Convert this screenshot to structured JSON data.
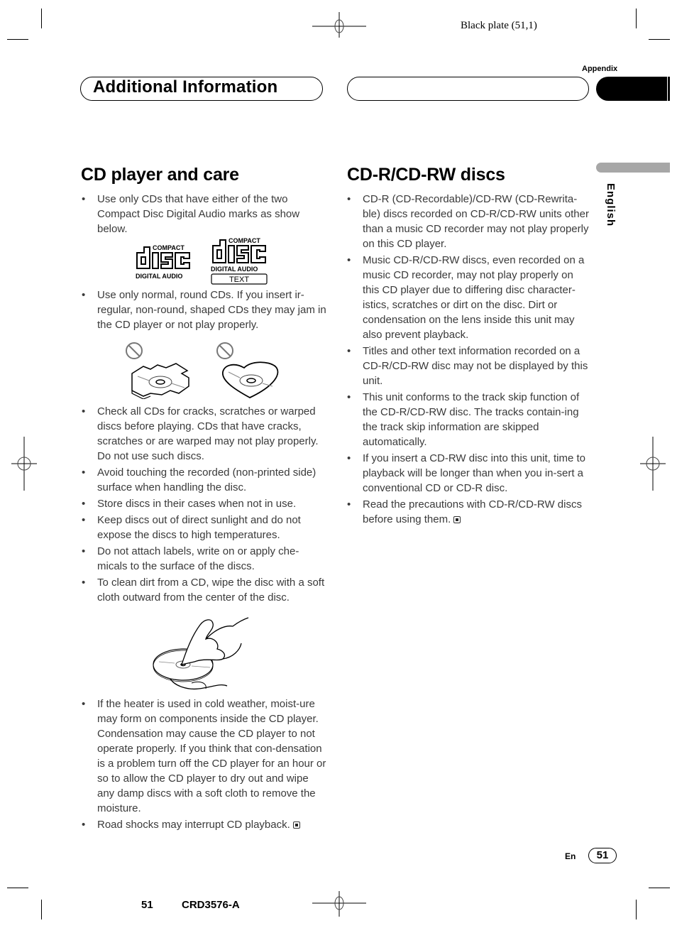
{
  "print_marks": {
    "plate_label": "Black plate (51,1)",
    "footer_page": "51",
    "footer_model": "CRD3576-A"
  },
  "header": {
    "section_title": "Additional Information",
    "chapter_label": "Appendix",
    "language_tab": "English"
  },
  "left_column": {
    "title": "CD player and care",
    "bullets_before_logos": [
      "Use only CDs that have either of the two Compact Disc Digital Audio marks as show below."
    ],
    "logos": [
      {
        "top": "COMPACT",
        "main": "disc",
        "bottom": "DIGITAL AUDIO"
      },
      {
        "top": "COMPACT",
        "main": "disc",
        "bottom": "DIGITAL AUDIO",
        "extra": "TEXT"
      }
    ],
    "bullets_before_shapes": [
      "Use only normal, round CDs. If you insert ir-regular, non-round, shaped CDs they may jam in the CD player or not play properly."
    ],
    "bullets_before_cleaning": [
      "Check all CDs for cracks, scratches or warped discs before playing. CDs that have cracks, scratches or are warped may not play properly. Do not use such discs.",
      "Avoid touching the recorded (non-printed side) surface when handling the disc.",
      "Store discs in their cases when not in use.",
      "Keep discs out of direct sunlight and do not expose the discs to high temperatures.",
      "Do not attach labels, write on or apply che-micals to the surface of the discs.",
      "To clean dirt from a CD, wipe the disc with a soft cloth outward from the center of the disc."
    ],
    "bullets_after_cleaning": [
      "If the heater is used in cold weather, moist-ure may form on components inside the CD player. Condensation may cause the CD player to not operate properly. If you think that con-densation is a problem turn off the CD player for an hour or so to allow the CD player to dry out and wipe any damp discs with a soft cloth to remove the moisture.",
      "Road shocks may interrupt CD playback."
    ]
  },
  "right_column": {
    "title": "CD-R/CD-RW discs",
    "bullets": [
      "CD-R (CD-Recordable)/CD-RW (CD-Rewrita-ble) discs recorded on CD-R/CD-RW units other than a music CD recorder may not play properly on this CD player.",
      "Music CD-R/CD-RW discs, even recorded on a music CD recorder, may not play properly on this CD player due to differing disc character-istics, scratches or dirt on the disc. Dirt or condensation on the lens inside this unit may also prevent playback.",
      "Titles and other text information recorded on a CD-R/CD-RW disc may not be displayed by this unit.",
      "This unit conforms to the track skip function of the CD-R/CD-RW disc. The tracks contain-ing the track skip information are skipped automatically.",
      "If you insert a CD-RW disc into this unit, time to playback will be longer than when you in-sert a conventional CD or CD-R disc.",
      "Read the precautions with CD-R/CD-RW discs before using them."
    ]
  },
  "footer": {
    "lang_code": "En",
    "page_number": "51"
  },
  "bullet_glyph": "•"
}
